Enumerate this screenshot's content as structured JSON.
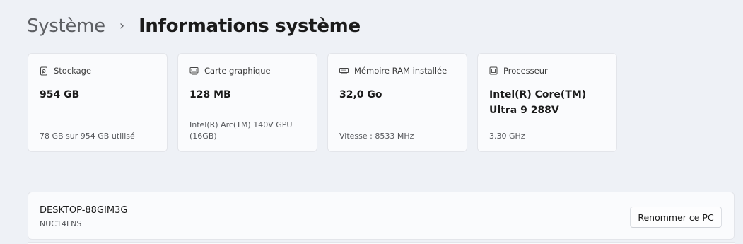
{
  "breadcrumb": {
    "parent": "Système",
    "separator": "›",
    "current": "Informations système"
  },
  "cards": [
    {
      "icon": "storage-icon",
      "label": "Stockage",
      "value": "954 GB",
      "detail": "78 GB sur 954 GB utilisé"
    },
    {
      "icon": "graphics-card-icon",
      "label": "Carte graphique",
      "value": "128 MB",
      "detail": "Intel(R) Arc(TM) 140V GPU (16GB)"
    },
    {
      "icon": "memory-icon",
      "label": "Mémoire RAM installée",
      "value": "32,0 Go",
      "detail": "Vitesse : 8533 MHz"
    },
    {
      "icon": "processor-icon",
      "label": "Processeur",
      "value": "Intel(R) Core(TM) Ultra 9 288V",
      "detail": "3.30 GHz"
    }
  ],
  "device": {
    "name": "DESKTOP-88GIM3G",
    "model": "NUC14LNS",
    "rename_label": "Renommer ce PC"
  },
  "colors": {
    "background": "#eef1f6",
    "card_background": "#fafbfd",
    "card_border": "#e3e5ea"
  }
}
